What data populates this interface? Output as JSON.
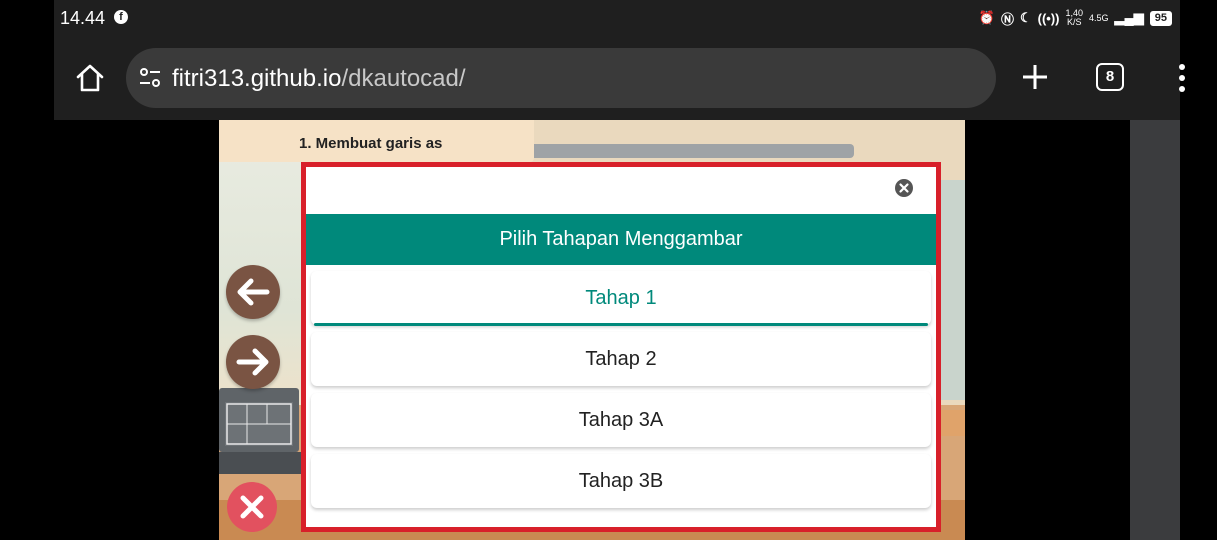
{
  "status_bar": {
    "time": "14.44",
    "speed_value": "1,40",
    "speed_unit": "K/S",
    "network": "4.5G",
    "battery": "95",
    "icons": [
      "facebook-icon",
      "alarm-icon",
      "nfc-icon",
      "moon-icon",
      "hotspot-icon",
      "signal-icon"
    ]
  },
  "browser": {
    "url_host": "fitri313.github.io",
    "url_path": "/dkautocad/",
    "tab_count": "8"
  },
  "page": {
    "heading": "1. Membuat garis as",
    "modal": {
      "title": "Pilih Tahapan Menggambar",
      "options": [
        {
          "label": "Tahap 1",
          "selected": true
        },
        {
          "label": "Tahap 2",
          "selected": false
        },
        {
          "label": "Tahap 3A",
          "selected": false
        },
        {
          "label": "Tahap 3B",
          "selected": false
        }
      ]
    }
  },
  "colors": {
    "accent": "#00897b",
    "modal_border": "#d8202a",
    "nav_button": "#7a5443",
    "close_button": "#e2515f"
  }
}
